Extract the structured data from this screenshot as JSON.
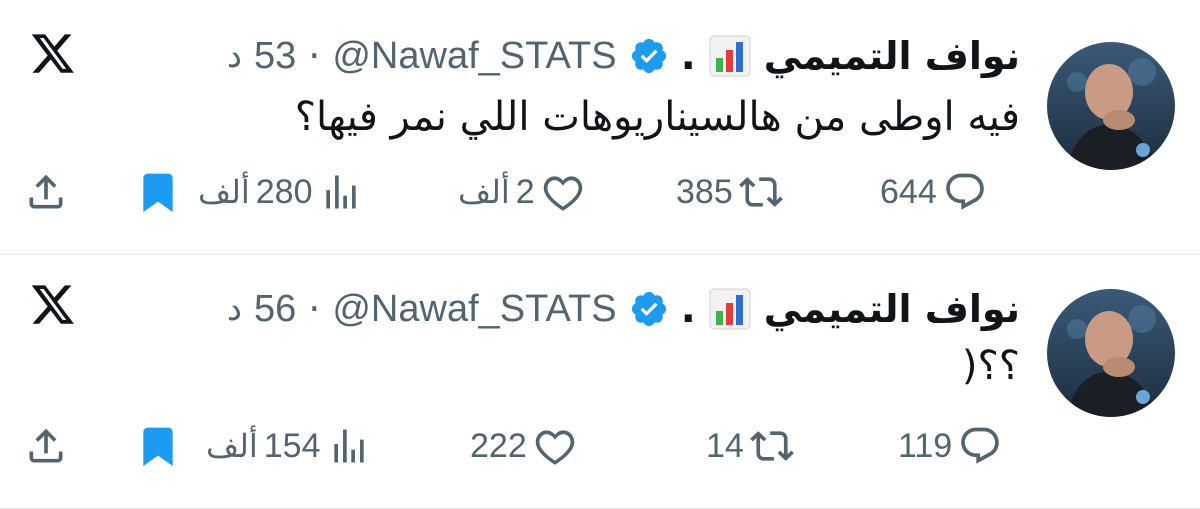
{
  "colors": {
    "text": "#0f1419",
    "secondary": "#536471",
    "verified": "#1d9bf0",
    "bookmark": "#1d9bf0"
  },
  "tweets": [
    {
      "author": {
        "name": "نواف التميمي",
        "dot": ".",
        "handle": "@Nawaf_STATS"
      },
      "separator": "·",
      "time": {
        "value": "53",
        "unit": "د"
      },
      "text": "فيه اوطى من هالسيناريوهات اللي نمر فيها؟",
      "stats": {
        "replies": "644",
        "retweets": "385",
        "likes": {
          "value": "2",
          "unit": "ألف"
        },
        "views": {
          "value": "280",
          "unit": "ألف"
        }
      }
    },
    {
      "author": {
        "name": "نواف التميمي",
        "dot": ".",
        "handle": "@Nawaf_STATS"
      },
      "separator": "·",
      "time": {
        "value": "56",
        "unit": "د"
      },
      "text": "؟؟(",
      "stats": {
        "replies": "119",
        "retweets": "14",
        "likes": {
          "value": "222",
          "unit": ""
        },
        "views": {
          "value": "154",
          "unit": "ألف"
        }
      }
    }
  ],
  "icons": {
    "logo": "x-logo-icon",
    "verified": "verified-badge-icon",
    "chart_emoji": "bar-chart-emoji-icon",
    "reply": "reply-bubble-icon",
    "retweet": "retweet-icon",
    "like": "heart-icon",
    "views": "views-bars-icon",
    "bookmark": "bookmark-icon",
    "share": "share-icon"
  }
}
